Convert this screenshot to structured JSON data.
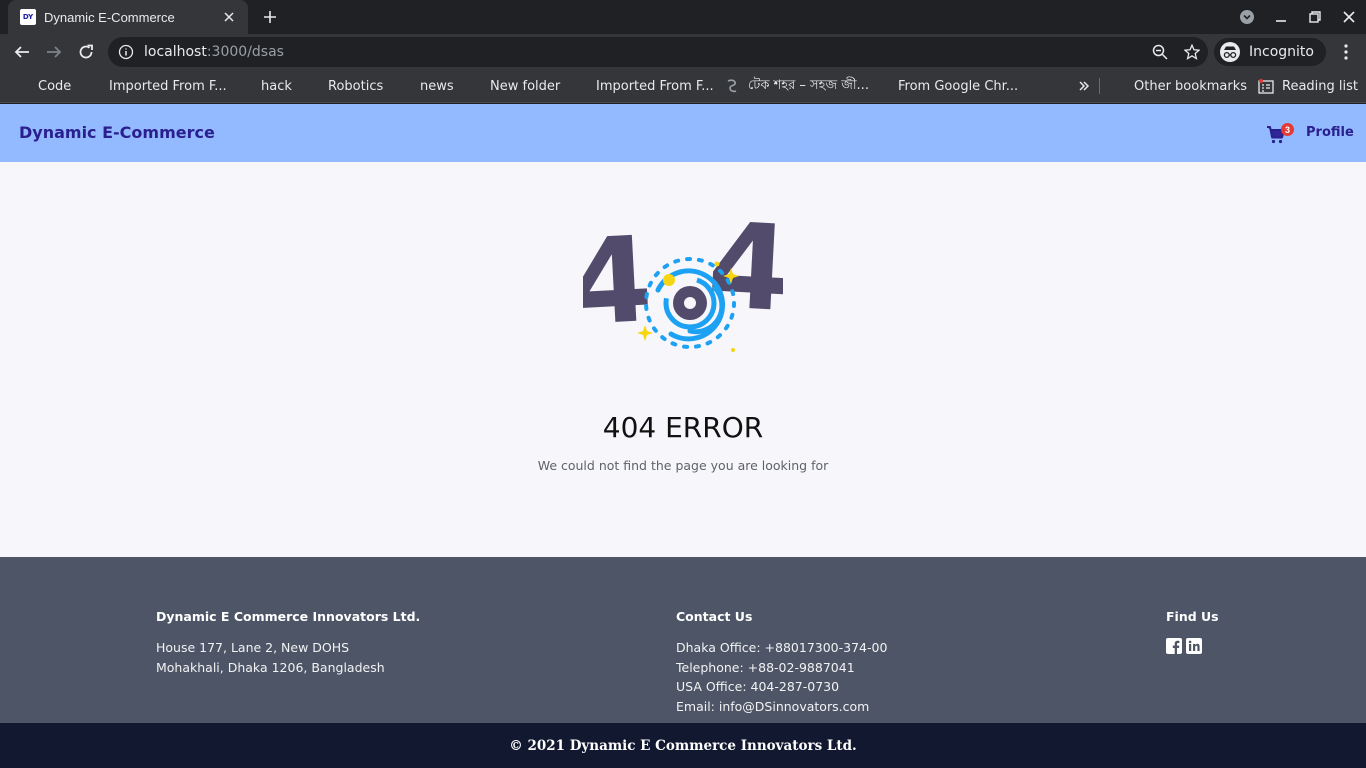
{
  "browser": {
    "tab": {
      "title": "Dynamic E-Commerce",
      "favicon_text": "DY"
    },
    "url": {
      "host": "localhost",
      "path": ":3000/dsas"
    },
    "profile_label": "Incognito",
    "bookmarks": [
      {
        "label": "Code",
        "icon": "folder-icon"
      },
      {
        "label": "Imported From F...",
        "icon": "folder-icon"
      },
      {
        "label": "hack",
        "icon": "folder-icon"
      },
      {
        "label": "Robotics",
        "icon": "folder-icon"
      },
      {
        "label": "news",
        "icon": "folder-icon"
      },
      {
        "label": "New folder",
        "icon": "folder-icon"
      },
      {
        "label": "Imported From F...",
        "icon": "folder-icon"
      },
      {
        "label": "টেক শহর – সহজ জী...",
        "icon": "site-icon"
      },
      {
        "label": "From Google Chr...",
        "icon": "folder-icon"
      }
    ],
    "other_bookmarks": "Other bookmarks",
    "reading_list": "Reading list"
  },
  "navbar": {
    "brand": "Dynamic E-Commerce",
    "cart_count": "3",
    "profile": "Profile"
  },
  "error": {
    "illustration_digits": [
      "4",
      "4"
    ],
    "title": "404 ERROR",
    "message": "We could not find the page you are looking for"
  },
  "footer": {
    "company": {
      "heading": "Dynamic E Commerce Innovators Ltd.",
      "lines": [
        "House 177, Lane 2, New DOHS",
        "Mohakhali, Dhaka 1206, Bangladesh"
      ]
    },
    "contact": {
      "heading": "Contact Us",
      "lines": [
        "Dhaka Office: +88017300-374-00",
        "Telephone: +88-02-9887041",
        "USA Office: 404-287-0730",
        "Email: info@DSinnovators.com"
      ]
    },
    "find": {
      "heading": "Find Us",
      "icons": [
        "facebook-icon",
        "linkedin-icon"
      ]
    },
    "copyright": "© 2021 Dynamic E Commerce Innovators Ltd."
  },
  "colors": {
    "navbar_bg": "#93b9fe",
    "brand_text": "#2a1f8f",
    "footer_bg": "#4d5566",
    "copyright_bg": "#111830",
    "digit_color": "#524b6b",
    "swirl_blue": "#1da1f2",
    "sparkle_yellow": "#f7d511"
  }
}
